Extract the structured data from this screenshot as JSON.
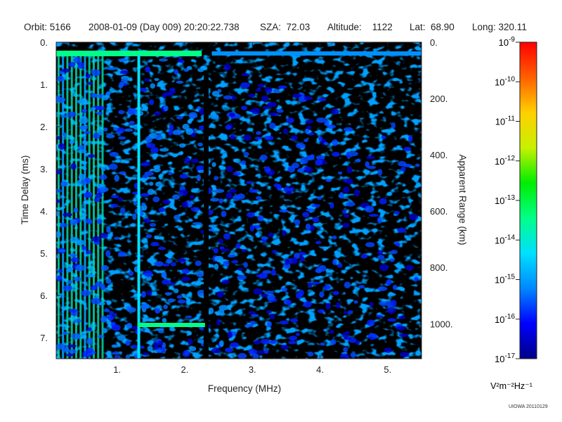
{
  "header": {
    "orbit": "Orbit: 5166",
    "date": "2008-01-09 (Day 009) 20:20:22.738",
    "sza": "SZA:  72.03",
    "altitude": "Altitude:    1122",
    "lat": "Lat:  68.90",
    "long": "Long: 320.11"
  },
  "chart_data": {
    "type": "heatmap",
    "xlabel": "Frequency (MHz)",
    "ylabel": "Time Delay (ms)",
    "y2label": "Apparent Range (km)",
    "colorbar_label": "V²m⁻²Hz⁻¹",
    "xlim": [
      0.1,
      5.5
    ],
    "ylim": [
      0.0,
      7.5
    ],
    "y_inverted": true,
    "x_ticks": [
      1,
      2,
      3,
      4,
      5
    ],
    "x_tick_labels": [
      "1.",
      "2.",
      "3.",
      "4.",
      "5."
    ],
    "y_ticks": [
      0,
      1,
      2,
      3,
      4,
      5,
      6,
      7
    ],
    "y_tick_labels": [
      "0.",
      "1.",
      "2.",
      "3.",
      "4.",
      "5.",
      "6.",
      "7."
    ],
    "y2_ticks_km": [
      0,
      200,
      400,
      600,
      800,
      1000
    ],
    "y2_tick_labels": [
      "0.",
      "200.",
      "400.",
      "600.",
      "800.",
      "1000."
    ],
    "km_per_ms": 149.9,
    "colorscale": {
      "scale": "log",
      "min_exponent": -17,
      "max_exponent": -9,
      "tick_base": "10",
      "tick_exponents": [
        "-9",
        "-10",
        "-11",
        "-12",
        "-13",
        "-14",
        "-15",
        "-16",
        "-17"
      ],
      "colors": [
        "#000088",
        "#0000ff",
        "#0088ff",
        "#00e0ff",
        "#00ff88",
        "#00ee00",
        "#c8f000",
        "#ffd000",
        "#ff6000",
        "#ff0000"
      ]
    },
    "features": {
      "ground_echo_delay_ms": 6.7,
      "ground_echo_freq_range_mhz": [
        1.3,
        2.3
      ],
      "spacecraft_local_echo_delay_ms": 0.25,
      "vertical_line_frequencies_mhz": [
        1.3,
        2.3
      ],
      "background_color": "#000000"
    }
  },
  "credit": "UIOWA 20110129"
}
